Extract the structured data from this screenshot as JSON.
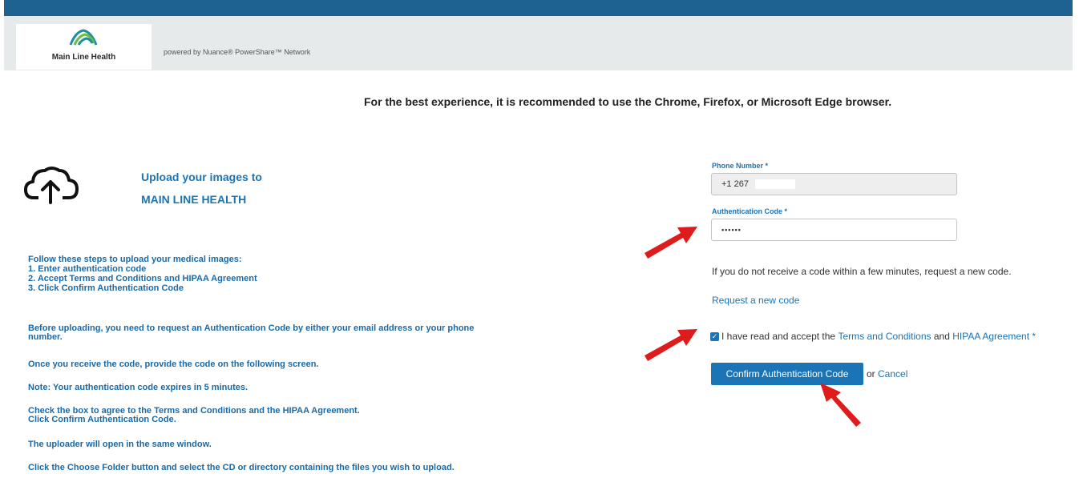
{
  "header": {
    "logo_text": "Main Line Health",
    "powered_by": "powered by Nuance® PowerShare™ Network"
  },
  "browser_note": "For the best experience, it is recommended to use the Chrome, Firefox, or Microsoft Edge browser.",
  "upload": {
    "title_line1": "Upload your images to",
    "title_line2": "MAIN LINE HEALTH"
  },
  "instructions": {
    "steps_intro": "Follow these steps to upload your medical images:",
    "step1": "1. Enter authentication code",
    "step2": "2. Accept Terms and Conditions and HIPAA Agreement",
    "step3": "3. Click Confirm Authentication Code",
    "para_before_line1": "Before uploading, you need to request an Authentication Code by either your email address or your phone",
    "para_before_line2": "number.",
    "para_once": "Once you receive the code, provide the code on the following screen.",
    "para_note": "Note: Your authentication code expires in 5 minutes.",
    "para_check_line1": "Check the box to agree to the Terms and Conditions and the HIPAA Agreement.",
    "para_check_line2": "Click Confirm Authentication Code.",
    "para_uploader": "The uploader will open in the same window.",
    "para_choose": "Click the Choose Folder button and select the CD or directory containing the files you wish to upload."
  },
  "form": {
    "phone_label": "Phone Number *",
    "phone_value": "+1 267",
    "code_label": "Authentication Code *",
    "code_value": "••••••",
    "resend_info": "If you do not receive a code within a few minutes, request a new code.",
    "request_link": "Request a new code",
    "terms_prefix": "I have read and accept the",
    "terms_link": "Terms and Conditions",
    "terms_and": "and",
    "hipaa_link": "HIPAA Agreement *",
    "confirm_label": "Confirm Authentication Code",
    "or_text": "or",
    "cancel_label": "Cancel"
  },
  "colors": {
    "topbar": "#1e6291",
    "accent": "#1a74b5",
    "arrow": "#e01b1b"
  }
}
